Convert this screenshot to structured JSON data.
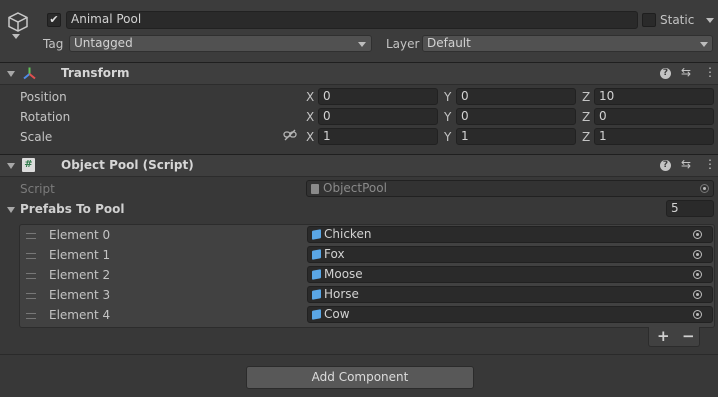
{
  "object": {
    "active": true,
    "name": "Animal Pool",
    "static_label": "Static",
    "static_checked": false,
    "tag_label": "Tag",
    "tag_value": "Untagged",
    "layer_label": "Layer",
    "layer_value": "Default"
  },
  "transform": {
    "title": "Transform",
    "rows": [
      {
        "label": "Position",
        "x": "0",
        "y": "0",
        "z": "10"
      },
      {
        "label": "Rotation",
        "x": "0",
        "y": "0",
        "z": "0"
      },
      {
        "label": "Scale",
        "x": "1",
        "y": "1",
        "z": "1"
      }
    ],
    "axis": {
      "x": "X",
      "y": "Y",
      "z": "Z"
    }
  },
  "object_pool": {
    "title": "Object Pool (Script)",
    "script_label": "Script",
    "script_value": "ObjectPool",
    "list_label": "Prefabs To Pool",
    "list_size": "5",
    "elements": [
      {
        "label": "Element 0",
        "value": "Chicken"
      },
      {
        "label": "Element 1",
        "value": "Fox"
      },
      {
        "label": "Element 2",
        "value": "Moose"
      },
      {
        "label": "Element 3",
        "value": "Horse"
      },
      {
        "label": "Element 4",
        "value": "Cow"
      }
    ],
    "add_symbol": "+",
    "remove_symbol": "−"
  },
  "add_component_label": "Add Component",
  "colors": {
    "background": "#383838",
    "header": "#3e3e3e",
    "field": "#2a2a2a",
    "prefab_icon": "#5aa7e6",
    "transform_icon_red": "#e05050",
    "transform_icon_green": "#63c35a",
    "transform_icon_blue": "#4f8be6"
  }
}
